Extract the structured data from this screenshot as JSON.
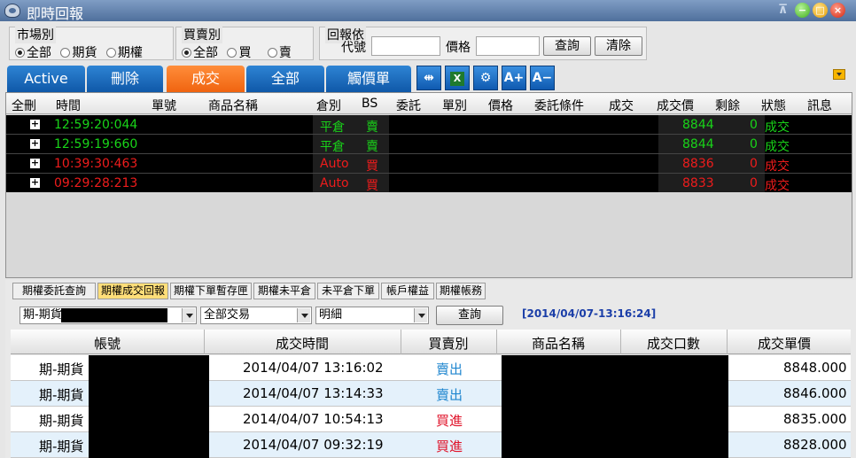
{
  "window": {
    "title": "即時回報"
  },
  "filters": {
    "market": {
      "label": "市場別",
      "options": [
        "全部",
        "期貨",
        "期權"
      ],
      "selected": 0
    },
    "side": {
      "label": "買賣別",
      "options": [
        "全部",
        "買",
        "賣"
      ],
      "selected": 0
    },
    "reply": {
      "label": "回報依",
      "code_label": "代號",
      "code_value": "",
      "price_label": "價格",
      "price_value": "",
      "query_btn": "查詢",
      "clear_btn": "清除"
    }
  },
  "tabs": [
    {
      "label": "Active"
    },
    {
      "label": "刪除"
    },
    {
      "label": "成交",
      "active": true
    },
    {
      "label": "全部"
    },
    {
      "label": "觸價單"
    }
  ],
  "toolbar": {
    "font_up": "A+",
    "font_down": "A−"
  },
  "grid": {
    "columns": [
      "全刪",
      "時間",
      "單號",
      "商品名稱",
      "倉別",
      "BS",
      "委託",
      "單別",
      "價格",
      "委託條件",
      "成交",
      "成交價",
      "剩餘",
      "狀態",
      "訊息"
    ],
    "rows": [
      {
        "time": "12:59:20:044",
        "pos": "平倉",
        "bs": "賣",
        "price": "8844",
        "remain": "0",
        "status": "成交",
        "color": "#19d419"
      },
      {
        "time": "12:59:19:660",
        "pos": "平倉",
        "bs": "賣",
        "price": "8844",
        "remain": "0",
        "status": "成交",
        "color": "#19d419"
      },
      {
        "time": "10:39:30:463",
        "pos": "Auto",
        "bs": "買",
        "price": "8836",
        "remain": "0",
        "status": "成交",
        "color": "#ee1c1c"
      },
      {
        "time": "09:29:28:213",
        "pos": "Auto",
        "bs": "買",
        "price": "8833",
        "remain": "0",
        "status": "成交",
        "color": "#ee1c1c"
      }
    ]
  },
  "lower_tabs": [
    "期權委託查詢",
    "期權成交回報",
    "期權下單暫存匣",
    "期權未平倉",
    "未平倉下單",
    "帳戶權益",
    "期權帳務"
  ],
  "lower_active": 1,
  "lower_filters": {
    "account_select": "期-期貨",
    "trade_select": "全部交易",
    "detail_select": "明細",
    "query_btn": "查詢",
    "timestamp": "[2014/04/07-13:16:24]"
  },
  "trade_table": {
    "columns": [
      "帳號",
      "成交時間",
      "買賣別",
      "商品名稱",
      "成交口數",
      "成交單價"
    ],
    "rows": [
      {
        "account": "期-期貨",
        "time": "2014/04/07 13:16:02",
        "side": "賣出",
        "side_color": "#1f86cf",
        "price": "8848.000"
      },
      {
        "account": "期-期貨",
        "time": "2014/04/07 13:14:33",
        "side": "賣出",
        "side_color": "#1f86cf",
        "price": "8846.000"
      },
      {
        "account": "期-期貨",
        "time": "2014/04/07 10:54:13",
        "side": "買進",
        "side_color": "#e0142b",
        "price": "8835.000"
      },
      {
        "account": "期-期貨",
        "time": "2014/04/07 09:32:19",
        "side": "買進",
        "side_color": "#e0142b",
        "price": "8828.000"
      }
    ]
  }
}
